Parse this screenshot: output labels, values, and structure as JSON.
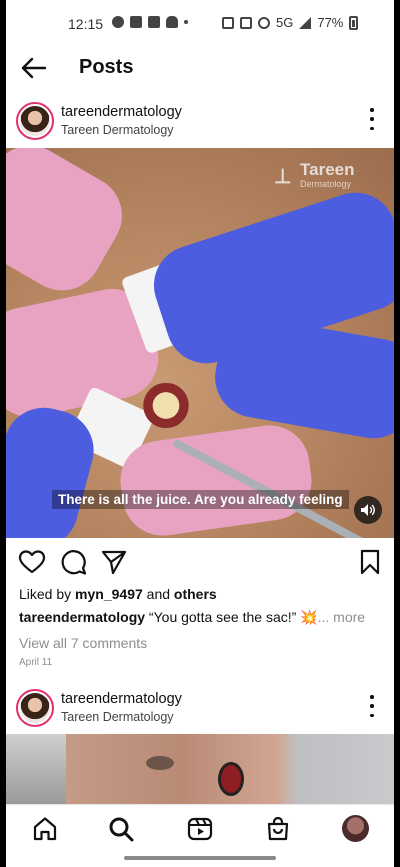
{
  "status_bar": {
    "time": "12:15",
    "network": "5G",
    "battery": "77%"
  },
  "header": {
    "title": "Posts"
  },
  "post": {
    "username": "tareendermatology",
    "display_name": "Tareen Dermatology",
    "video": {
      "logo_name": "Tareen",
      "logo_sub": "Dermatology",
      "subtitle": "There is all the juice. Are you already feeling"
    },
    "liked_by_prefix": "Liked by ",
    "liked_by_user": "myn_9497",
    "liked_by_joiner": " and ",
    "liked_by_others": "others",
    "caption_author": "tareendermatology",
    "caption_text": " “You gotta see the sac!” 💥",
    "caption_more": "... more",
    "view_comments": "View all 7 comments",
    "date": "April 11"
  },
  "next_post": {
    "username": "tareendermatology",
    "display_name": "Tareen Dermatology"
  },
  "colors": {
    "story_ring": "#e1306c",
    "secondary_text": "#8e8e8e"
  }
}
